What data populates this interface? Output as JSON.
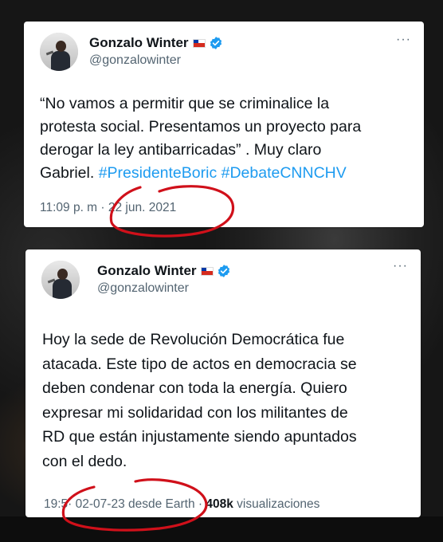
{
  "tweets": [
    {
      "name": "Gonzalo Winter",
      "handle": "@gonzalowinter",
      "text_main": "“No vamos a permitir que se criminalice la\nprotesta social.  Presentamos un proyecto para\nderogar la ley antibarricadas” . Muy claro\nGabriel. ",
      "hashtags": [
        "#PresidenteBoric",
        "#DebateCNNCHV"
      ],
      "time_visible": "11:09 p. m",
      "date": "22 jun. 2021",
      "more_label": "···"
    },
    {
      "name": "Gonzalo Winter",
      "handle": "@gonzalowinter",
      "text": "Hoy la sede de Revolución Democrática fue\natacada. Este tipo de actos en democracia se\ndeben condenar con toda la energía. Quiero\nexpresar mi solidaridad con los militantes de\nRD que están injustamente siendo apuntados\ncon el dedo.",
      "time_visible": "19:5",
      "date_source": "· 02-07-23 desde ",
      "source_visible": "Earth",
      "views_count": "408k",
      "views_label": "visualizaciones",
      "more_label": "···"
    }
  ],
  "colors": {
    "hashtag": "#1d9bf0",
    "verified_badge": "#1d9bf0",
    "annotation_circle": "#d0101a",
    "meta_text": "#536471"
  },
  "icons": [
    "verified-badge-icon",
    "chile-flag-icon",
    "more-options-icon",
    "avatar-image"
  ]
}
